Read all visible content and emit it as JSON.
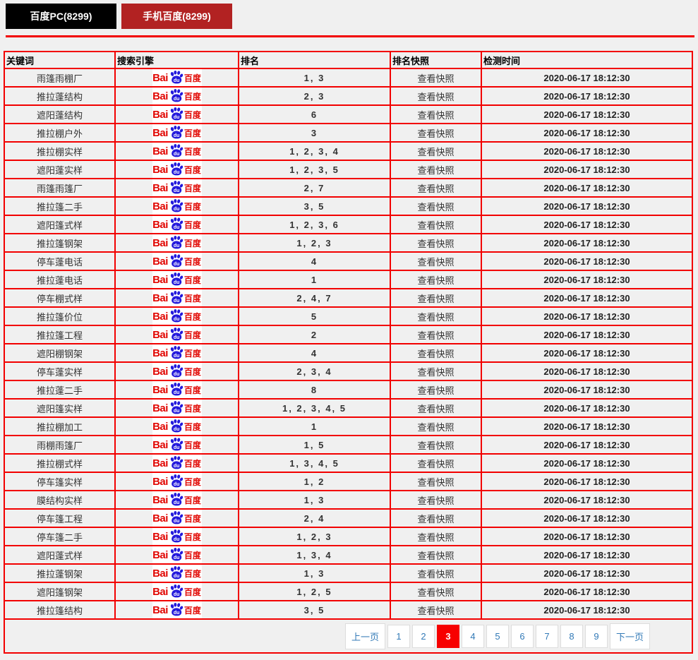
{
  "tabs": [
    {
      "id": "pc",
      "label": "百度PC(8299)"
    },
    {
      "id": "mobile",
      "label": "手机百度(8299)"
    }
  ],
  "table": {
    "headers": [
      "关键词",
      "搜索引擎",
      "排名",
      "排名快照",
      "检测时间"
    ],
    "snapshot_label": "查看快照",
    "rows": [
      {
        "keyword": "雨篷雨棚厂",
        "rank": "1, 3",
        "time": "2020-06-17 18:12:30"
      },
      {
        "keyword": "推拉蓬结构",
        "rank": "2, 3",
        "time": "2020-06-17 18:12:30"
      },
      {
        "keyword": "遮阳蓬结构",
        "rank": "6",
        "time": "2020-06-17 18:12:30"
      },
      {
        "keyword": "推拉棚户外",
        "rank": "3",
        "time": "2020-06-17 18:12:30"
      },
      {
        "keyword": "推拉棚实样",
        "rank": "1, 2, 3, 4",
        "time": "2020-06-17 18:12:30"
      },
      {
        "keyword": "遮阳蓬实样",
        "rank": "1, 2, 3, 5",
        "time": "2020-06-17 18:12:30"
      },
      {
        "keyword": "雨篷雨篷厂",
        "rank": "2, 7",
        "time": "2020-06-17 18:12:30"
      },
      {
        "keyword": "推拉篷二手",
        "rank": "3, 5",
        "time": "2020-06-17 18:12:30"
      },
      {
        "keyword": "遮阳篷式样",
        "rank": "1, 2, 3, 6",
        "time": "2020-06-17 18:12:30"
      },
      {
        "keyword": "推拉篷钢架",
        "rank": "1, 2, 3",
        "time": "2020-06-17 18:12:30"
      },
      {
        "keyword": "停车蓬电话",
        "rank": "4",
        "time": "2020-06-17 18:12:30"
      },
      {
        "keyword": "推拉蓬电话",
        "rank": "1",
        "time": "2020-06-17 18:12:30"
      },
      {
        "keyword": "停车棚式样",
        "rank": "2, 4, 7",
        "time": "2020-06-17 18:12:30"
      },
      {
        "keyword": "推拉篷价位",
        "rank": "5",
        "time": "2020-06-17 18:12:30"
      },
      {
        "keyword": "推拉篷工程",
        "rank": "2",
        "time": "2020-06-17 18:12:30"
      },
      {
        "keyword": "遮阳棚钢架",
        "rank": "4",
        "time": "2020-06-17 18:12:30"
      },
      {
        "keyword": "停车蓬实样",
        "rank": "2, 3, 4",
        "time": "2020-06-17 18:12:30"
      },
      {
        "keyword": "推拉蓬二手",
        "rank": "8",
        "time": "2020-06-17 18:12:30"
      },
      {
        "keyword": "遮阳篷实样",
        "rank": "1, 2, 3, 4, 5",
        "time": "2020-06-17 18:12:30"
      },
      {
        "keyword": "推拉棚加工",
        "rank": "1",
        "time": "2020-06-17 18:12:30"
      },
      {
        "keyword": "雨棚雨篷厂",
        "rank": "1, 5",
        "time": "2020-06-17 18:12:30"
      },
      {
        "keyword": "推拉棚式样",
        "rank": "1, 3, 4, 5",
        "time": "2020-06-17 18:12:30"
      },
      {
        "keyword": "停车篷实样",
        "rank": "1, 2",
        "time": "2020-06-17 18:12:30"
      },
      {
        "keyword": "膜结构实样",
        "rank": "1, 3",
        "time": "2020-06-17 18:12:30"
      },
      {
        "keyword": "停车篷工程",
        "rank": "2, 4",
        "time": "2020-06-17 18:12:30"
      },
      {
        "keyword": "停车篷二手",
        "rank": "1, 2, 3",
        "time": "2020-06-17 18:12:30"
      },
      {
        "keyword": "遮阳蓬式样",
        "rank": "1, 3, 4",
        "time": "2020-06-17 18:12:30"
      },
      {
        "keyword": "推拉蓬钢架",
        "rank": "1, 3",
        "time": "2020-06-17 18:12:30"
      },
      {
        "keyword": "遮阳篷钢架",
        "rank": "1, 2, 5",
        "time": "2020-06-17 18:12:30"
      },
      {
        "keyword": "推拉篷结构",
        "rank": "3, 5",
        "time": "2020-06-17 18:12:30"
      }
    ]
  },
  "logo": {
    "bai": "Bai",
    "du": "du",
    "cn": "百度"
  },
  "pagination": {
    "prev": "上一页",
    "next": "下一页",
    "pages": [
      "1",
      "2",
      "3",
      "4",
      "5",
      "6",
      "7",
      "8",
      "9"
    ],
    "active": "3"
  },
  "colors": {
    "border_red": "#f20000",
    "tab_pc_bg": "#000000",
    "tab_mobile_bg": "#b22222",
    "active_page_bg": "#f70000",
    "pagination_link": "#337ab7",
    "logo_red": "#e10601",
    "logo_blue": "#2319dc",
    "row_bg": "#f0f0f0"
  }
}
